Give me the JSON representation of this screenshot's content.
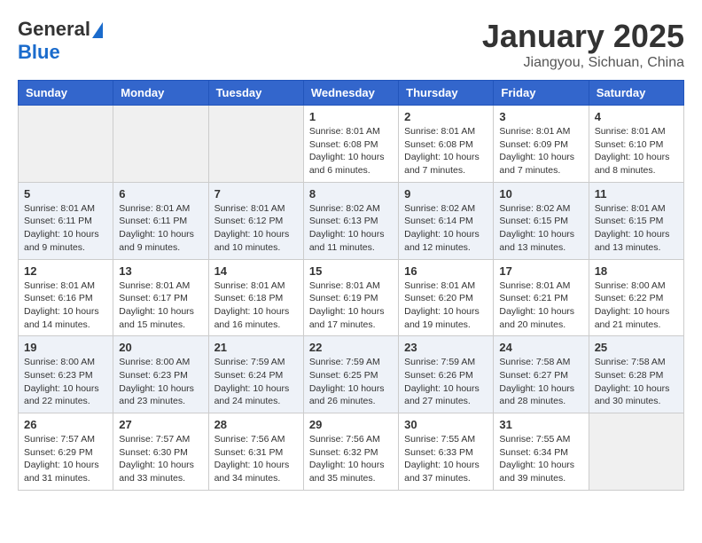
{
  "header": {
    "logo_general": "General",
    "logo_blue": "Blue",
    "main_title": "January 2025",
    "subtitle": "Jiangyou, Sichuan, China"
  },
  "weekdays": [
    "Sunday",
    "Monday",
    "Tuesday",
    "Wednesday",
    "Thursday",
    "Friday",
    "Saturday"
  ],
  "weeks": [
    [
      {
        "day": "",
        "info": ""
      },
      {
        "day": "",
        "info": ""
      },
      {
        "day": "",
        "info": ""
      },
      {
        "day": "1",
        "info": "Sunrise: 8:01 AM\nSunset: 6:08 PM\nDaylight: 10 hours\nand 6 minutes."
      },
      {
        "day": "2",
        "info": "Sunrise: 8:01 AM\nSunset: 6:08 PM\nDaylight: 10 hours\nand 7 minutes."
      },
      {
        "day": "3",
        "info": "Sunrise: 8:01 AM\nSunset: 6:09 PM\nDaylight: 10 hours\nand 7 minutes."
      },
      {
        "day": "4",
        "info": "Sunrise: 8:01 AM\nSunset: 6:10 PM\nDaylight: 10 hours\nand 8 minutes."
      }
    ],
    [
      {
        "day": "5",
        "info": "Sunrise: 8:01 AM\nSunset: 6:11 PM\nDaylight: 10 hours\nand 9 minutes."
      },
      {
        "day": "6",
        "info": "Sunrise: 8:01 AM\nSunset: 6:11 PM\nDaylight: 10 hours\nand 9 minutes."
      },
      {
        "day": "7",
        "info": "Sunrise: 8:01 AM\nSunset: 6:12 PM\nDaylight: 10 hours\nand 10 minutes."
      },
      {
        "day": "8",
        "info": "Sunrise: 8:02 AM\nSunset: 6:13 PM\nDaylight: 10 hours\nand 11 minutes."
      },
      {
        "day": "9",
        "info": "Sunrise: 8:02 AM\nSunset: 6:14 PM\nDaylight: 10 hours\nand 12 minutes."
      },
      {
        "day": "10",
        "info": "Sunrise: 8:02 AM\nSunset: 6:15 PM\nDaylight: 10 hours\nand 13 minutes."
      },
      {
        "day": "11",
        "info": "Sunrise: 8:01 AM\nSunset: 6:15 PM\nDaylight: 10 hours\nand 13 minutes."
      }
    ],
    [
      {
        "day": "12",
        "info": "Sunrise: 8:01 AM\nSunset: 6:16 PM\nDaylight: 10 hours\nand 14 minutes."
      },
      {
        "day": "13",
        "info": "Sunrise: 8:01 AM\nSunset: 6:17 PM\nDaylight: 10 hours\nand 15 minutes."
      },
      {
        "day": "14",
        "info": "Sunrise: 8:01 AM\nSunset: 6:18 PM\nDaylight: 10 hours\nand 16 minutes."
      },
      {
        "day": "15",
        "info": "Sunrise: 8:01 AM\nSunset: 6:19 PM\nDaylight: 10 hours\nand 17 minutes."
      },
      {
        "day": "16",
        "info": "Sunrise: 8:01 AM\nSunset: 6:20 PM\nDaylight: 10 hours\nand 19 minutes."
      },
      {
        "day": "17",
        "info": "Sunrise: 8:01 AM\nSunset: 6:21 PM\nDaylight: 10 hours\nand 20 minutes."
      },
      {
        "day": "18",
        "info": "Sunrise: 8:00 AM\nSunset: 6:22 PM\nDaylight: 10 hours\nand 21 minutes."
      }
    ],
    [
      {
        "day": "19",
        "info": "Sunrise: 8:00 AM\nSunset: 6:23 PM\nDaylight: 10 hours\nand 22 minutes."
      },
      {
        "day": "20",
        "info": "Sunrise: 8:00 AM\nSunset: 6:23 PM\nDaylight: 10 hours\nand 23 minutes."
      },
      {
        "day": "21",
        "info": "Sunrise: 7:59 AM\nSunset: 6:24 PM\nDaylight: 10 hours\nand 24 minutes."
      },
      {
        "day": "22",
        "info": "Sunrise: 7:59 AM\nSunset: 6:25 PM\nDaylight: 10 hours\nand 26 minutes."
      },
      {
        "day": "23",
        "info": "Sunrise: 7:59 AM\nSunset: 6:26 PM\nDaylight: 10 hours\nand 27 minutes."
      },
      {
        "day": "24",
        "info": "Sunrise: 7:58 AM\nSunset: 6:27 PM\nDaylight: 10 hours\nand 28 minutes."
      },
      {
        "day": "25",
        "info": "Sunrise: 7:58 AM\nSunset: 6:28 PM\nDaylight: 10 hours\nand 30 minutes."
      }
    ],
    [
      {
        "day": "26",
        "info": "Sunrise: 7:57 AM\nSunset: 6:29 PM\nDaylight: 10 hours\nand 31 minutes."
      },
      {
        "day": "27",
        "info": "Sunrise: 7:57 AM\nSunset: 6:30 PM\nDaylight: 10 hours\nand 33 minutes."
      },
      {
        "day": "28",
        "info": "Sunrise: 7:56 AM\nSunset: 6:31 PM\nDaylight: 10 hours\nand 34 minutes."
      },
      {
        "day": "29",
        "info": "Sunrise: 7:56 AM\nSunset: 6:32 PM\nDaylight: 10 hours\nand 35 minutes."
      },
      {
        "day": "30",
        "info": "Sunrise: 7:55 AM\nSunset: 6:33 PM\nDaylight: 10 hours\nand 37 minutes."
      },
      {
        "day": "31",
        "info": "Sunrise: 7:55 AM\nSunset: 6:34 PM\nDaylight: 10 hours\nand 39 minutes."
      },
      {
        "day": "",
        "info": ""
      }
    ]
  ]
}
